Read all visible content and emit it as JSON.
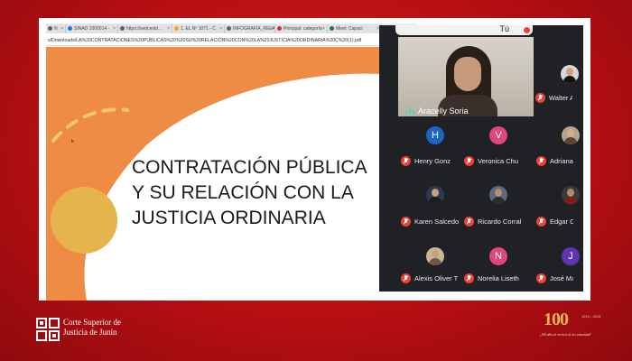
{
  "browser": {
    "tabs": [
      {
        "label": "N",
        "color": "#5f6368"
      },
      {
        "label": "SINAD 1000014 - ",
        "color": "#1a73e8"
      },
      {
        "label": "https://sedcesb/...",
        "color": "#5f6368"
      },
      {
        "label": "1. EL Nº 1071 - C",
        "color": "#f9ab00"
      },
      {
        "label": "INFOGRAFÍA_RELA",
        "color": "#5f6368"
      },
      {
        "label": "Principal: categoría",
        "color": "#d93025"
      },
      {
        "label": "Meet: Capaci",
        "color": "#188038"
      }
    ],
    "url": "s/Downloads/LA%20CONTRATACIONES%20PÚBLICAS%20%20SU%20RELACIÓN%20CON%20LA%20JUSTICIA%20ORDINARIA%20C%20(1).pdf"
  },
  "slide": {
    "title_lines": [
      "CONTRATACIÓN PÚBLICA",
      "Y SU RELACIÓN CON LA",
      "JUSTICIA ORDINARIA"
    ],
    "colors": {
      "orange": "#ee8b45",
      "gold": "#e6b44c",
      "dash": "#f3c86a"
    }
  },
  "meet": {
    "self_label": "Tú",
    "speaker": {
      "name": "Aracelly Soria"
    },
    "participants": [
      {
        "name": "Walter A",
        "kind": "photo",
        "bg": "#d8d8d8",
        "skin": "#c9a182",
        "shirt": "#111111"
      },
      {
        "name": "Henry Gonz",
        "kind": "letter",
        "letter": "H",
        "bg": "#1e63c6"
      },
      {
        "name": "Veronica Chu",
        "kind": "letter",
        "letter": "V",
        "bg": "#e0457b"
      },
      {
        "name": "Adriana",
        "kind": "photo",
        "bg": "#b8a48e",
        "skin": "#d9b08c",
        "shirt": "#5a4636"
      },
      {
        "name": "Karen Salcedo",
        "kind": "photo",
        "bg": "#2b3a4e",
        "skin": "#c7a07f",
        "shirt": "#1d1d1d"
      },
      {
        "name": "Ricardo Corral",
        "kind": "photo",
        "bg": "#5b6b80",
        "skin": "#b98d6a",
        "shirt": "#2c2c2c"
      },
      {
        "name": "Edgar Ca",
        "kind": "photo",
        "bg": "#3a3a3a",
        "skin": "#b48a68",
        "shirt": "#8b1c1c"
      },
      {
        "name": "Alexis Oliver T",
        "kind": "photo",
        "bg": "#c9b79a",
        "skin": "#caa07e",
        "shirt": "#6a5a46"
      },
      {
        "name": "Norelia Liseth",
        "kind": "letter",
        "letter": "N",
        "bg": "#e0457b"
      },
      {
        "name": "José Ma",
        "kind": "letter",
        "letter": "J",
        "bg": "#5e35b1"
      }
    ]
  },
  "footer": {
    "org_line1": "Corte Superior de",
    "org_line2": "Justicia de Junín",
    "anniversary": {
      "number": "100",
      "years": "1919 - 2019",
      "slogan": "¡100 años al servicio de la comunidad!"
    }
  }
}
